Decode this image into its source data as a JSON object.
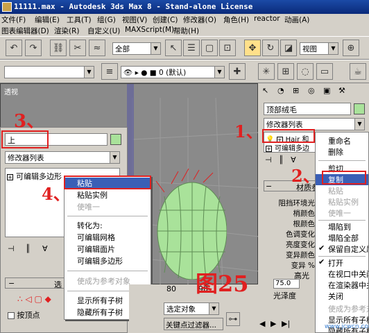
{
  "title_bar": {
    "title": "11111.max - Autodesk 3ds Max 8 - Stand-alone License"
  },
  "menu_row1": [
    "文件(F)",
    "编辑(E)",
    "工具(T)",
    "组(G)",
    "视图(V)",
    "创建(C)",
    "修改器(O)",
    "角色(H)",
    "reactor",
    "动画(A)"
  ],
  "menu_row2": [
    "图表编辑器(D)",
    "渲染(R)",
    "自定义(U)",
    "MAXScript(M)",
    "帮助(H)"
  ],
  "toolbar": {
    "selection_filter": "全部",
    "view_dropdown": "视图",
    "layer_name": "0 (默认)"
  },
  "viewport": {
    "label": "透视"
  },
  "left_panel": {
    "name_field": "上",
    "modifier_list": "修改器列表",
    "stack_item": "可编辑多边形",
    "rollout_label": "选",
    "checkbox_label": "按顶点"
  },
  "left_context_menu": {
    "items": [
      {
        "label": "粘贴",
        "state": "highlighted"
      },
      {
        "label": "粘贴实例",
        "state": "normal"
      },
      {
        "label": "使唯一",
        "state": "disabled"
      },
      {
        "label": "转化为:",
        "state": "normal"
      },
      {
        "label": "可编辑网格",
        "state": "normal"
      },
      {
        "label": "可编辑面片",
        "state": "normal"
      },
      {
        "label": "可编辑多边形",
        "state": "normal"
      },
      {
        "label": "使成为参考对象",
        "state": "disabled"
      },
      {
        "label": "显示所有子树",
        "state": "normal"
      },
      {
        "label": "隐藏所有子树",
        "state": "normal"
      }
    ]
  },
  "right_panel": {
    "object_name": "顶部绒毛",
    "modifier_list": "修改器列表",
    "stack_items": [
      "Hair 和",
      "可编辑多边"
    ],
    "material_rollout": "材质参",
    "params": [
      "阻挡环境光",
      "梢颜色",
      "根颜色",
      "色调变化",
      "亮度变化",
      "变异颜色",
      "变异 %",
      "高光"
    ],
    "spinner_value": "75.0",
    "gloss_label": "光泽度"
  },
  "right_context_menu": {
    "items": [
      {
        "label": "重命名",
        "state": "normal"
      },
      {
        "label": "删除",
        "state": "normal"
      },
      {
        "label": "剪切",
        "state": "normal"
      },
      {
        "label": "复制",
        "state": "highlighted"
      },
      {
        "label": "粘贴",
        "state": "disabled"
      },
      {
        "label": "粘贴实例",
        "state": "disabled"
      },
      {
        "label": "使唯一",
        "state": "disabled"
      },
      {
        "label": "塌陷到",
        "state": "normal"
      },
      {
        "label": "塌陷全部",
        "state": "normal"
      },
      {
        "label": "保留自定义属性",
        "state": "checked"
      },
      {
        "label": "打开",
        "state": "checked"
      },
      {
        "label": "在视口中关闭",
        "state": "normal"
      },
      {
        "label": "在渲染器中关闭",
        "state": "normal"
      },
      {
        "label": "关闭",
        "state": "normal"
      },
      {
        "label": "使成为参考对象",
        "state": "disabled"
      },
      {
        "label": "显示所有子树",
        "state": "normal"
      },
      {
        "label": "隐藏所有子树",
        "state": "normal"
      }
    ]
  },
  "bottom_bar": {
    "frame_80": "80",
    "frame_90": "90",
    "selection_dropdown": "选定对象",
    "key_filter": "关键点过滤器..."
  },
  "annotations": {
    "step1": "1、",
    "step2": "2、",
    "step3": "3、",
    "step4": "4、",
    "figure": "图25"
  },
  "watermark": "www.jcwcn.com",
  "colors": {
    "highlight": "#3a5fb6",
    "annotation_red": "#e02020",
    "title_blue": "#0a2a7a",
    "object_green": "#a9e29a"
  }
}
